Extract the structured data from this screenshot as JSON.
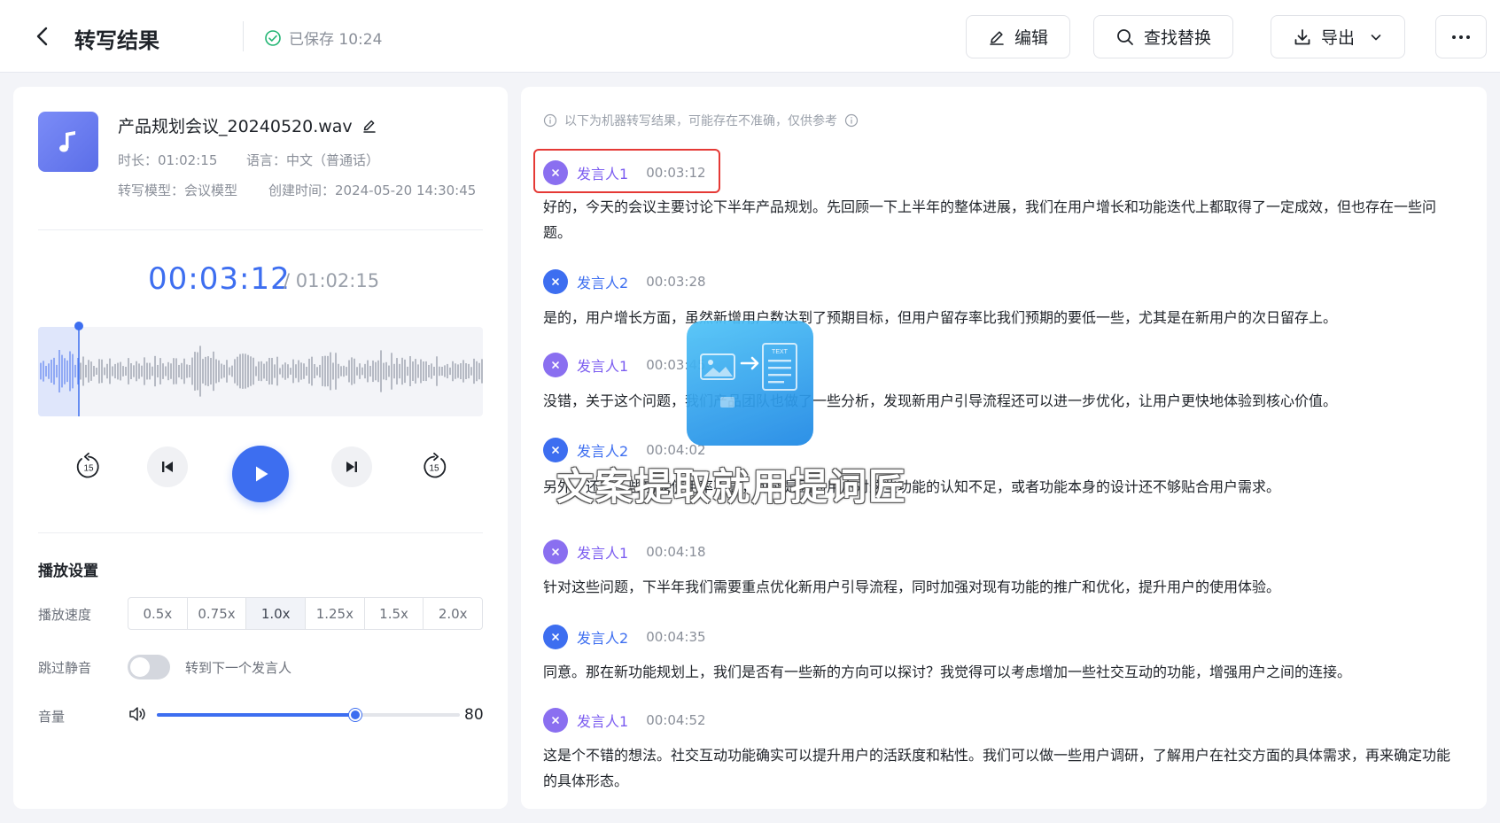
{
  "header": {
    "title": "转写结果",
    "saved_status": "已保存 10:24",
    "edit_label": "编辑",
    "find_replace_label": "查找替换",
    "export_label": "导出"
  },
  "file": {
    "name": "产品规划会议_20240520.wav",
    "duration": "时长：01:02:15",
    "language": "语言：中文（普通话）",
    "model": "转写模型：会议模型",
    "created": "创建时间：2024-05-20 14:30:45"
  },
  "player": {
    "current_time": "00:03:12",
    "total_time": "/ 01:02:15",
    "progress": 0.051,
    "rewind_seconds": "15",
    "forward_seconds": "15"
  },
  "settings": {
    "title": "播放设置",
    "speed_label": "播放速度",
    "speed_options": [
      "0.5x",
      "0.75x",
      "1.0x",
      "1.25x",
      "1.5x",
      "2.0x"
    ],
    "speed_selected": "1.0x",
    "skip_silence_label": "跳过静音",
    "skip_silence_on": false,
    "next_speaker_label": "转到下一个发言人",
    "volume_label": "音量",
    "volume": 80
  },
  "transcript": {
    "notice": "以下为机器转写结果，可能存在不准确，仅供参考",
    "segments": [
      {
        "speaker": "发言人1",
        "time": "00:03:12",
        "text": "好的，今天的会议主要讨论下半年产品规划。先回顾一下上半年的整体进展，我们在用户增长和功能迭代上都取得了一定成效，但也存在一些问题。"
      },
      {
        "speaker": "发言人2",
        "time": "00:03:28",
        "text": "是的，用户增长方面，虽然新增用户数达到了预期目标，但用户留存率比我们预期的要低一些，尤其是在新用户的次日留存上。"
      },
      {
        "speaker": "发言人1",
        "time": "00:03:45",
        "text": "没错，关于这个问题，我们产品团队也做了一些分析，发现新用户引导流程还可以进一步优化，让用户更快地体验到核心价值。"
      },
      {
        "speaker": "发言人2",
        "time": "00:04:02",
        "text": "另外，还有一些功能使用率不高，可能是因为用户对这些功能的认知不足，或者功能本身的设计还不够贴合用户需求。"
      },
      {
        "speaker": "发言人1",
        "time": "00:04:18",
        "text": "针对这些问题，下半年我们需要重点优化新用户引导流程，同时加强对现有功能的推广和优化，提升用户的使用体验。"
      },
      {
        "speaker": "发言人2",
        "time": "00:04:35",
        "text": "同意。那在新功能规划上，我们是否有一些新的方向可以探讨？我觉得可以考虑增加一些社交互动的功能，增强用户之间的连接。"
      },
      {
        "speaker": "发言人1",
        "time": "00:04:52",
        "text": "这是个不错的想法。社交互动功能确实可以提升用户的活跃度和粘性。我们可以做一些用户调研，了解用户在社交方面的具体需求，再来确定功能的具体形态。"
      }
    ]
  },
  "watermark": {
    "text": "文案提取就用提词匠",
    "logo_text": "TEXT"
  },
  "colors": {
    "accent": "#3d6ef0",
    "speaker1": "#7b5cf0",
    "speaker2": "#3d6ef0",
    "highlight": "#e53935"
  }
}
